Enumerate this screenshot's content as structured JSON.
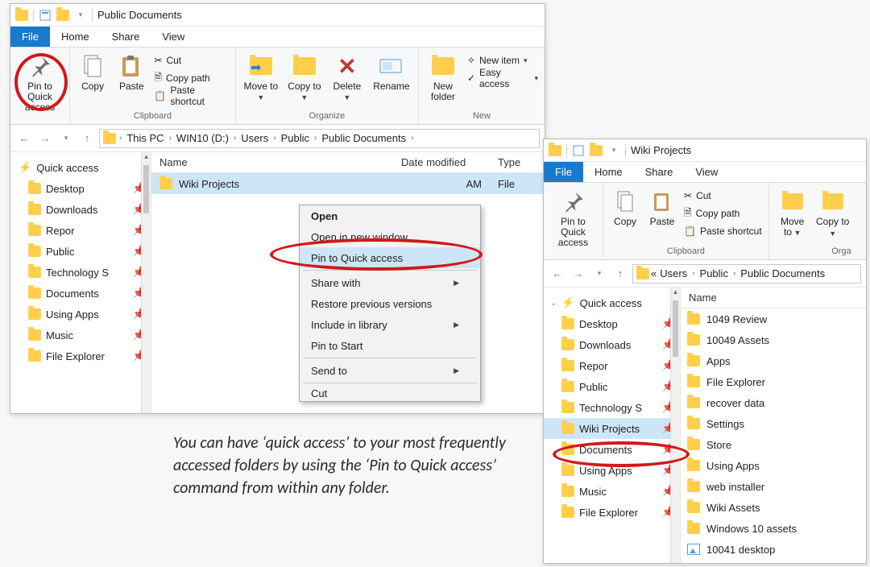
{
  "win1": {
    "title": "Public Documents",
    "tabs": {
      "file": "File",
      "home": "Home",
      "share": "Share",
      "view": "View"
    },
    "ribbon": {
      "pin": "Pin to Quick access",
      "copy": "Copy",
      "paste": "Paste",
      "cut": "Cut",
      "copypath": "Copy path",
      "pasteshort": "Paste shortcut",
      "clipboard_label": "Clipboard",
      "moveto": "Move to",
      "copyto": "Copy to",
      "delete": "Delete",
      "rename": "Rename",
      "organize_label": "Organize",
      "newfolder": "New folder",
      "newitem": "New item",
      "easyaccess": "Easy access",
      "new_label": "New"
    },
    "crumbs": [
      "This PC",
      "WIN10 (D:)",
      "Users",
      "Public",
      "Public Documents"
    ],
    "cols": {
      "name": "Name",
      "date": "Date modified",
      "type": "Type"
    },
    "row": {
      "name": "Wiki Projects",
      "date": "AM",
      "type": "File"
    },
    "sidebar": {
      "quick": "Quick access",
      "items": [
        {
          "label": "Desktop",
          "icon": "desktop"
        },
        {
          "label": "Downloads",
          "icon": "downloads"
        },
        {
          "label": "Repor",
          "icon": "folder"
        },
        {
          "label": "Public",
          "icon": "folder"
        },
        {
          "label": "Technology S",
          "icon": "folder"
        },
        {
          "label": "Documents",
          "icon": "documents"
        },
        {
          "label": "Using Apps",
          "icon": "folder"
        },
        {
          "label": "Music",
          "icon": "music"
        },
        {
          "label": "File Explorer",
          "icon": "folder"
        }
      ]
    },
    "ctx": {
      "open": "Open",
      "openwin": "Open in new window",
      "pin": "Pin to Quick access",
      "share": "Share with",
      "restore": "Restore previous versions",
      "include": "Include in library",
      "pinstart": "Pin to Start",
      "sendto": "Send to",
      "cut": "Cut"
    }
  },
  "win2": {
    "title": "Wiki Projects",
    "tabs": {
      "file": "File",
      "home": "Home",
      "share": "Share",
      "view": "View"
    },
    "ribbon": {
      "pin": "Pin to Quick access",
      "copy": "Copy",
      "paste": "Paste",
      "cut": "Cut",
      "copypath": "Copy path",
      "pasteshort": "Paste shortcut",
      "clipboard_label": "Clipboard",
      "moveto": "Move to",
      "copyto": "Copy to",
      "organize_label": "Orga"
    },
    "crumbs_lead": "«",
    "crumbs": [
      "Users",
      "Public",
      "Public Documents"
    ],
    "cols": {
      "name": "Name"
    },
    "sidebar": {
      "quick": "Quick access",
      "items": [
        {
          "label": "Desktop"
        },
        {
          "label": "Downloads"
        },
        {
          "label": "Repor"
        },
        {
          "label": "Public"
        },
        {
          "label": "Technology S"
        },
        {
          "label": "Wiki Projects"
        },
        {
          "label": "Documents"
        },
        {
          "label": "Using Apps"
        },
        {
          "label": "Music"
        },
        {
          "label": "File Explorer"
        }
      ]
    },
    "files": [
      "1049 Review",
      "10049 Assets",
      "Apps",
      "File Explorer",
      "recover data",
      "Settings",
      "Store",
      "Using Apps",
      "web installer",
      "Wiki Assets",
      "Windows 10 assets",
      "10041 desktop"
    ]
  },
  "caption": "You can have ‘quick access’ to your most frequently accessed folders by using the ‘Pin to Quick access’ command from within any folder."
}
